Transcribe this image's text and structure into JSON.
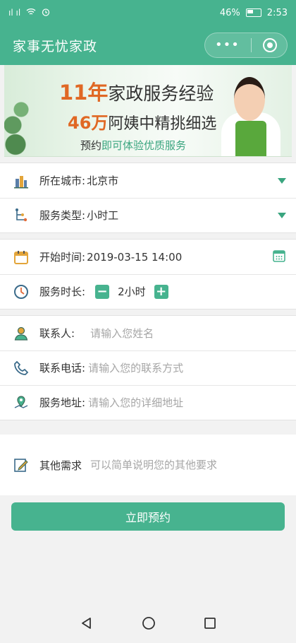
{
  "status_bar": {
    "signal_left": "ᯈᯈ",
    "battery_percent": "46%",
    "time": "2:53"
  },
  "navbar": {
    "title": "家事无忧家政",
    "more_icon": "more-dots-icon",
    "close_icon": "target-icon"
  },
  "banner": {
    "line1_highlight": "11年",
    "line1_text": "家政服务经验",
    "line2_highlight": "46万",
    "line2_text": "阿姨中精挑细选",
    "line3_prefix": "预约",
    "line3_green": "即可体验优质服务"
  },
  "location_section": {
    "city_label": "所在城市:",
    "city_value": "北京市",
    "service_label": "服务类型:",
    "service_value": "小时工"
  },
  "time_section": {
    "start_label": "开始时间:",
    "start_value": "2019-03-15 14:00",
    "duration_label": "服务时长:",
    "duration_minus": "−",
    "duration_value": "2小时",
    "duration_plus": "+"
  },
  "contact_section": {
    "name_label": "联系人:",
    "name_placeholder": "请输入您姓名",
    "phone_label": "联系电话:",
    "phone_placeholder": "请输入您的联系方式",
    "address_label": "服务地址:",
    "address_placeholder": "请输入您的详细地址"
  },
  "other": {
    "label": "其他需求",
    "placeholder": "可以简单说明您的其他要求"
  },
  "submit_label": "立即预约",
  "colors": {
    "primary": "#47b38f",
    "accent_orange": "#e06824",
    "placeholder": "#a6a6a6"
  }
}
